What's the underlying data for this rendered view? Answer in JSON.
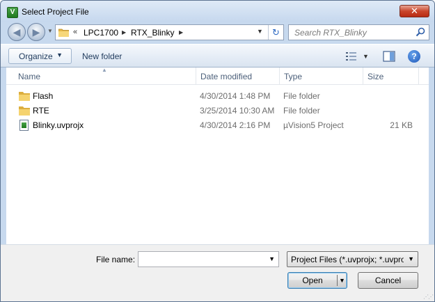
{
  "window": {
    "title": "Select Project File",
    "app_icon_letter": "V",
    "close_glyph": "✕"
  },
  "nav": {
    "back_glyph": "◀",
    "forward_glyph": "▶",
    "breadcrumb_overflow": "«",
    "breadcrumbs": [
      "LPC1700",
      "RTX_Blinky"
    ],
    "separator_glyph": "▶",
    "refresh_glyph": "↻",
    "search_placeholder": "Search RTX_Blinky"
  },
  "toolbar": {
    "organize_label": "Organize",
    "new_folder_label": "New folder",
    "help_glyph": "?"
  },
  "columns": {
    "name": "Name",
    "date": "Date modified",
    "type": "Type",
    "size": "Size"
  },
  "files": [
    {
      "name": "Flash",
      "date": "4/30/2014 1:48 PM",
      "type": "File folder",
      "size": "",
      "icon": "folder-icon"
    },
    {
      "name": "RTE",
      "date": "3/25/2014 10:30 AM",
      "type": "File folder",
      "size": "",
      "icon": "folder-icon"
    },
    {
      "name": "Blinky.uvprojx",
      "date": "4/30/2014 2:16 PM",
      "type": "µVision5 Project",
      "size": "21 KB",
      "icon": "uvision-project-icon"
    }
  ],
  "footer": {
    "file_name_label": "File name:",
    "file_name_value": "",
    "filter_value": "Project Files (*.uvprojx; *.uvproj)",
    "open_label": "Open",
    "cancel_label": "Cancel"
  },
  "colors": {
    "frame": "#c7d9ee",
    "accent_blue": "#1e395b",
    "close_red": "#c9462c",
    "folder_yellow": "#f0c75a"
  }
}
